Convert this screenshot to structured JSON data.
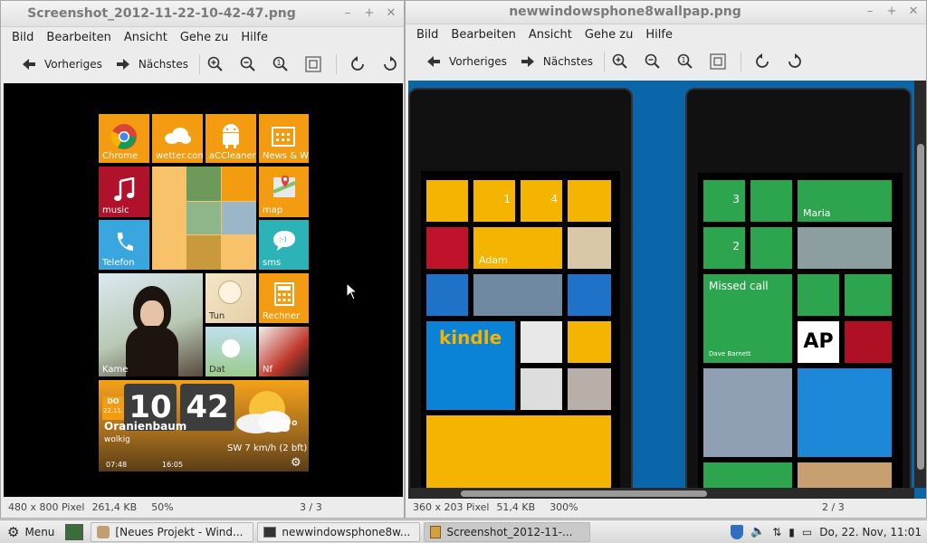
{
  "left_window": {
    "title": "Screenshot_2012-11-22-10-42-47.png",
    "menu": [
      "Bild",
      "Bearbeiten",
      "Ansicht",
      "Gehe zu",
      "Hilfe"
    ],
    "toolbar": {
      "prev_label": "Vorheriges",
      "next_label": "Nächstes"
    },
    "status": {
      "dimensions": "480 x 800 Pixel",
      "size": "261,4 KB",
      "zoom": "50%",
      "page": "3 / 3"
    },
    "tiles": {
      "chrome": "Chrome",
      "wetter": "wetter.com",
      "accleaner": "aCCleaner",
      "news": "News & W",
      "music": "music",
      "map": "map",
      "telefon": "Telefon",
      "sms": "sms",
      "tun": "Tun",
      "rechner": "Rechner",
      "kamera": "Kame",
      "dat": "Dat",
      "nfs": "Nf"
    },
    "weather": {
      "day": "DO",
      "date": "22.11.",
      "hour": "10",
      "minute": "42",
      "city": "Oranienbaum",
      "condition": "wolkig",
      "temp": "7.5°",
      "wind": "SW 7 km/h (2 bft)",
      "sunrise": "07:48",
      "sunset": "16:05"
    }
  },
  "right_window": {
    "title": "newwindowsphone8wallpap.png",
    "menu": [
      "Bild",
      "Bearbeiten",
      "Ansicht",
      "Gehe zu",
      "Hilfe"
    ],
    "toolbar": {
      "prev_label": "Vorheriges",
      "next_label": "Nächstes"
    },
    "status": {
      "dimensions": "360 x 203 Pixel",
      "size": "51,4 KB",
      "zoom": "300%",
      "page": "2 / 3"
    },
    "phone1": {
      "tile_adam": "Adam",
      "tile_kindle": "kindle",
      "tile_msg_count": "1",
      "tile_chat_count": "4"
    },
    "phone2": {
      "tile_maria": "Maria",
      "tile_missed": "Missed call",
      "tile_missed_name": "Dave Barnett",
      "tile_ap": "AP",
      "tile_phone_count": "3",
      "tile_msg_count": "2"
    }
  },
  "taskbar": {
    "menu_label": "Menu",
    "tasks": [
      {
        "label": "[Neues Projekt - Wind..."
      },
      {
        "label": "newwindowsphone8w..."
      },
      {
        "label": "Screenshot_2012-11-..."
      }
    ],
    "clock": "Do, 22. Nov, 11:01"
  },
  "colors": {
    "orange": "#f39c12",
    "wp_yellow": "#f4b400",
    "wp_green": "#2da44e",
    "wp_blue": "#0a66a8"
  }
}
